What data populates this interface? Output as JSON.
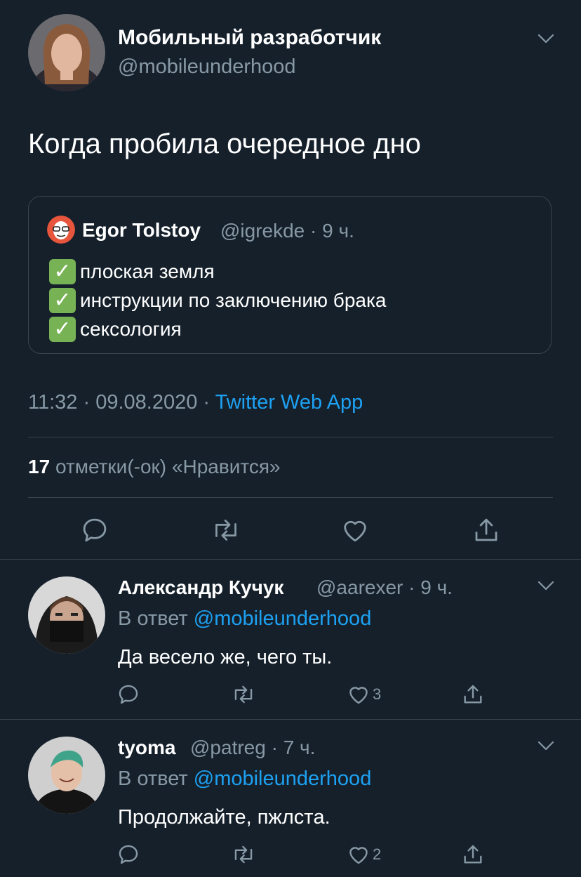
{
  "tweet": {
    "author_name": "Мобильный разработчик",
    "author_handle": "@mobileunderhood",
    "text": "Когда пробила очередное дно",
    "timestamp": "11:32 · 09.08.2020 ·",
    "source": "Twitter Web App",
    "likes_count": "17",
    "likes_label": "отметки(-ок) «Нравится»",
    "quote": {
      "author_name": "Egor Tolstoy",
      "meta": "@igrekde · 9 ч.",
      "lines": [
        "плоская земля",
        "инструкции по заключению брака",
        "сексология"
      ],
      "check_glyph": "✓"
    }
  },
  "replies": [
    {
      "author_name": "Александр Кучук",
      "meta": "@aarexer · 9 ч.",
      "reply_prefix": "В ответ",
      "reply_to": "@mobileunderhood",
      "text": "Да весело же, чего ты.",
      "like_count": "3"
    },
    {
      "author_name": "tyoma",
      "meta": "@patreg · 7 ч.",
      "reply_prefix": "В ответ",
      "reply_to": "@mobileunderhood",
      "text": "Продолжайте, пжлстa.",
      "like_count": "2"
    }
  ],
  "colors": {
    "background": "#15202b",
    "muted": "#8899a6",
    "link": "#1da1f2",
    "divider": "#38444d",
    "check": "#77b255"
  },
  "icons": [
    "chevron-down-icon",
    "reply-icon",
    "retweet-icon",
    "like-icon",
    "share-icon",
    "check-icon"
  ]
}
